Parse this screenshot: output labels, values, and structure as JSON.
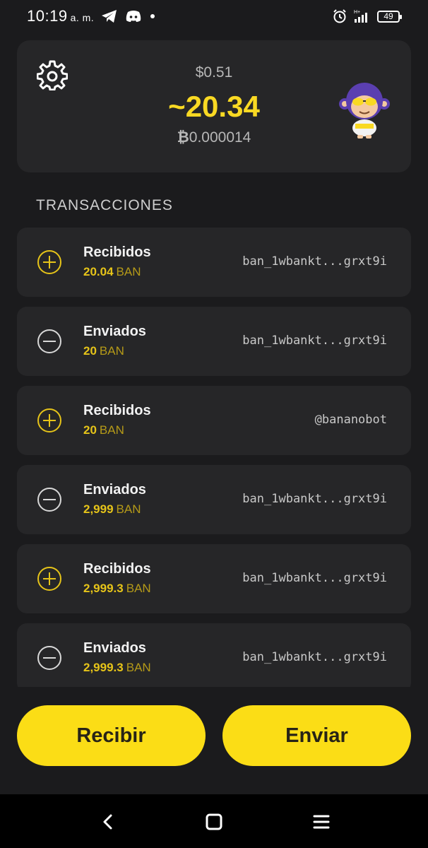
{
  "status_bar": {
    "time": "10:19",
    "time_suffix": "a. m.",
    "network": "H+",
    "battery": "49",
    "icons": [
      "telegram-icon",
      "discord-icon",
      "dot-icon",
      "alarm-icon",
      "signal-icon",
      "battery-icon"
    ]
  },
  "balance": {
    "fiat": "$0.51",
    "ban_symbol": "~",
    "ban": "20.34",
    "btc_symbol": "₿",
    "btc": "0.000014",
    "settings_icon": "gear-icon",
    "avatar": "monkey-avatar"
  },
  "transactions": {
    "title": "TRANSACCIONES",
    "items": [
      {
        "type": "Recibidos",
        "amount": "20.04",
        "unit": "BAN",
        "address": "ban_1wbankt...grxt9i",
        "icon": "plus-circle-icon"
      },
      {
        "type": "Enviados",
        "amount": "20",
        "unit": "BAN",
        "address": "ban_1wbankt...grxt9i",
        "icon": "minus-circle-icon"
      },
      {
        "type": "Recibidos",
        "amount": "20",
        "unit": "BAN",
        "address": "@bananobot",
        "icon": "plus-circle-icon"
      },
      {
        "type": "Enviados",
        "amount": "2,999",
        "unit": "BAN",
        "address": "ban_1wbankt...grxt9i",
        "icon": "minus-circle-icon"
      },
      {
        "type": "Recibidos",
        "amount": "2,999.3",
        "unit": "BAN",
        "address": "ban_1wbankt...grxt9i",
        "icon": "plus-circle-icon"
      },
      {
        "type": "Enviados",
        "amount": "2,999.3",
        "unit": "BAN",
        "address": "ban_1wbankt...grxt9i",
        "icon": "minus-circle-icon"
      }
    ]
  },
  "actions": {
    "receive_label": "Recibir",
    "send_label": "Enviar"
  },
  "colors": {
    "accent": "#fbdd16",
    "background": "#1b1b1d",
    "card": "#262628"
  }
}
